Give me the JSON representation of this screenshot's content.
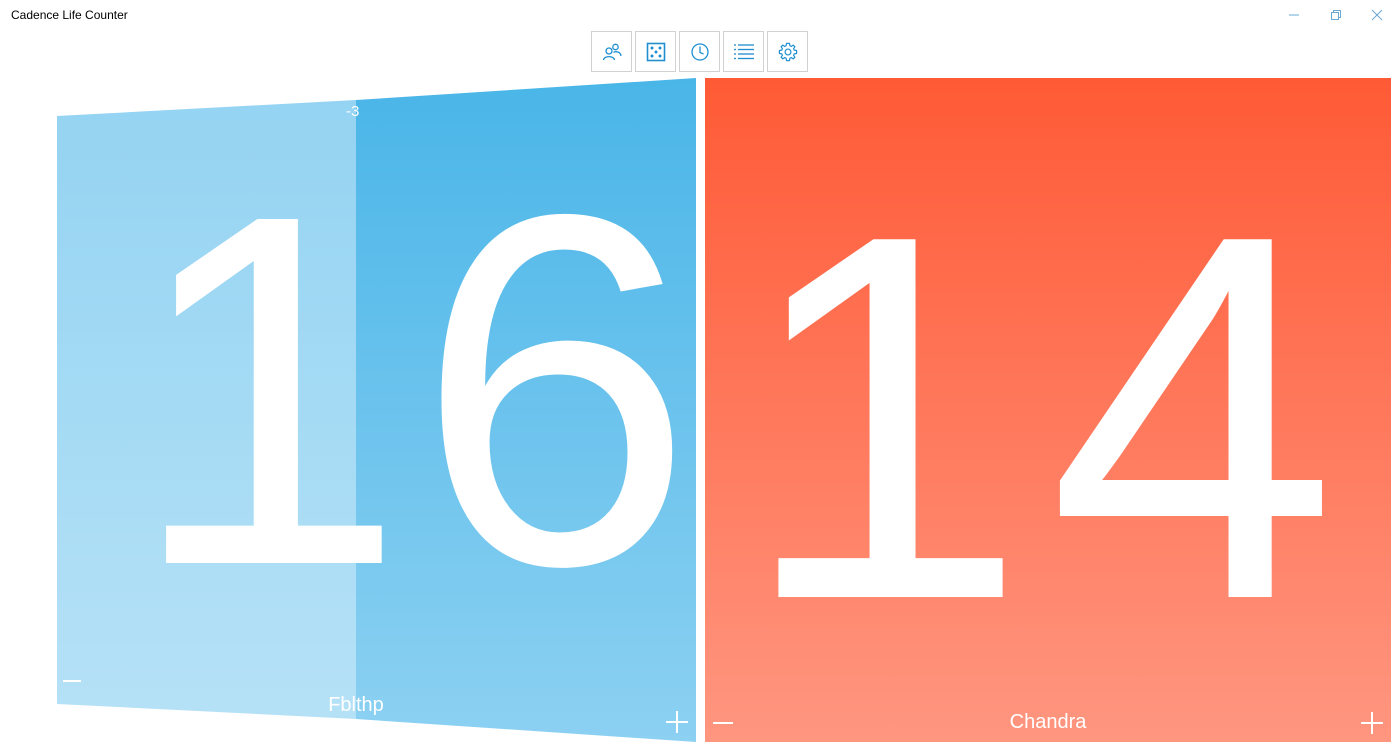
{
  "window": {
    "title": "Cadence Life Counter",
    "controls": [
      "minimize-icon",
      "restore-icon",
      "close-icon"
    ]
  },
  "toolbar": {
    "buttons": [
      {
        "icon": "players-icon"
      },
      {
        "icon": "dice-icon"
      },
      {
        "icon": "clock-icon"
      },
      {
        "icon": "list-icon"
      },
      {
        "icon": "gear-icon"
      }
    ],
    "accent": "#1f8fd0"
  },
  "players": [
    {
      "name": "Fblthp",
      "life": "16",
      "delta": "-3",
      "colors": {
        "top": "#42b2e7",
        "bottom": "#8dd1f2"
      }
    },
    {
      "name": "Chandra",
      "life": "14",
      "colors": {
        "top": "#ff5a36",
        "bottom": "#ff9680"
      }
    }
  ]
}
